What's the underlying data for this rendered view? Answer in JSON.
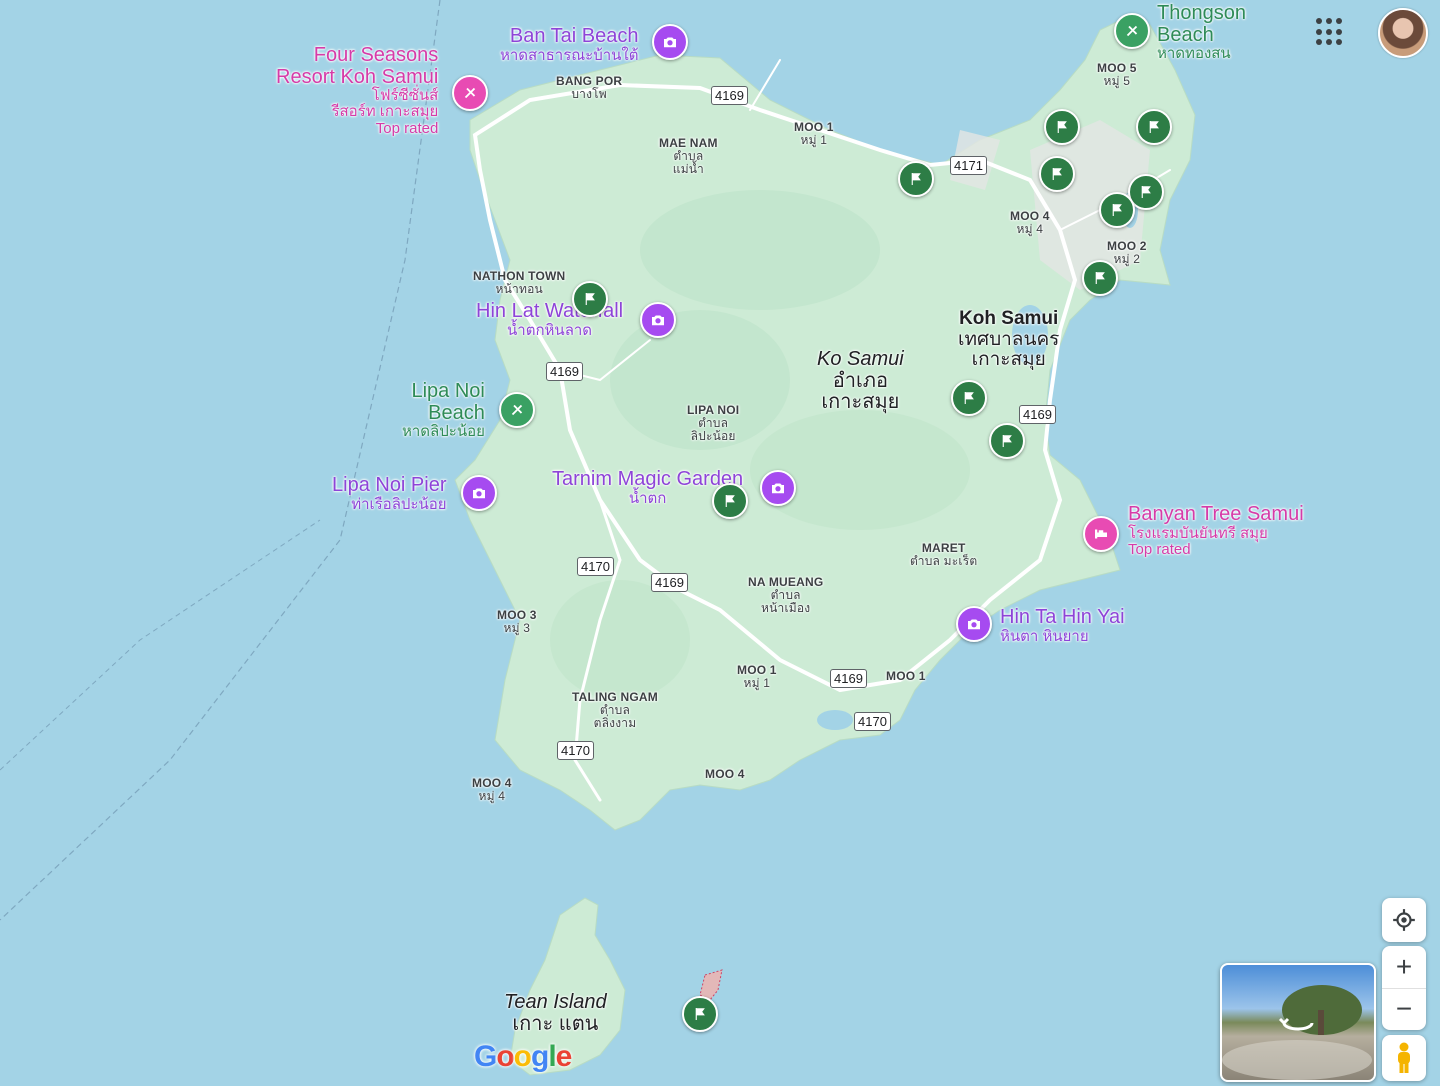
{
  "map": {
    "colors": {
      "water": "#a3d3e6",
      "land": "#cdebd5",
      "land_dark": "#b8e0c2",
      "urban": "#e8eaed",
      "road": "#ffffff"
    },
    "areas": [
      {
        "en": "BANG POR",
        "th": "บางโพ"
      },
      {
        "en": "MAE NAM",
        "th": "ตำบล\nแม่น้ำ"
      },
      {
        "en": "MOO 1",
        "th": "หมู่ 1"
      },
      {
        "en": "MOO 5",
        "th": "หมู่ 5"
      },
      {
        "en": "MOO 4",
        "th": "หมู่ 4"
      },
      {
        "en": "MOO 2",
        "th": "หมู่ 2"
      },
      {
        "en": "NATHON TOWN",
        "th": "หน้าทอน"
      },
      {
        "en": "LIPA NOI",
        "th": "ตำบล\nลิปะน้อย"
      },
      {
        "en": "MARET",
        "th": "ตำบล มะเร็ต"
      },
      {
        "en": "NA MUEANG",
        "th": "ตำบล\nหน้าเมือง"
      },
      {
        "en": "MOO 3",
        "th": "หมู่ 3"
      },
      {
        "en": "MOO 1",
        "th": "หมู่ 1"
      },
      {
        "en": "MOO 1",
        "th": ""
      },
      {
        "en": "TALING NGAM",
        "th": "ตำบล\nตลิ่งงาม"
      },
      {
        "en": "MOO 4",
        "th": "หมู่ 4"
      },
      {
        "en": "MOO 4",
        "th": ""
      }
    ],
    "city": {
      "en": "Koh Samui",
      "th": "เทศบาลนคร\nเกาะสมุย"
    },
    "district": {
      "en": "Ko Samui",
      "th": "อำเภอ\nเกาะสมุย"
    },
    "island": {
      "en": "Tean Island",
      "th": "เกาะ แตน"
    },
    "pois": {
      "ban_tai_beach": {
        "name": "Ban Tai Beach",
        "th": "หาดสาธารณะบ้านใต้",
        "icon": "camera-icon"
      },
      "four_seasons": {
        "name": "Four Seasons\nResort Koh Samui",
        "th": "โฟร์ซีซั่นส์\nรีสอร์ท เกาะสมุย",
        "badge": "Top rated",
        "icon": "resort-icon"
      },
      "thongson_beach": {
        "name": "Thongson\nBeach",
        "th": "หาดทองสน",
        "icon": "beach-icon"
      },
      "hin_lat_waterfall": {
        "name": "Hin Lat Waterfall",
        "th": "น้ำตกหินลาด",
        "icon": "camera-icon"
      },
      "lipa_noi_beach": {
        "name": "Lipa Noi\nBeach",
        "th": "หาดลิปะน้อย",
        "icon": "beach-icon"
      },
      "lipa_noi_pier": {
        "name": "Lipa Noi Pier",
        "th": "ท่าเรือลิปะน้อย",
        "icon": "camera-icon"
      },
      "tarnim_magic_garden": {
        "name": "Tarnim Magic Garden",
        "th": "น้ำตก",
        "icon": "camera-icon"
      },
      "banyan_tree": {
        "name": "Banyan Tree Samui",
        "th": "โรงแรมบันยันทรี สมุย",
        "badge": "Top rated",
        "icon": "hotel-icon"
      },
      "hin_ta_hin_yai": {
        "name": "Hin Ta Hin Yai",
        "th": "หินตา หินยาย",
        "icon": "camera-icon"
      }
    },
    "roads": [
      "4169",
      "4171",
      "4169",
      "4169",
      "4170",
      "4169",
      "4169",
      "4170",
      "4170"
    ]
  },
  "controls": {
    "my_location_icon": "crosshair-icon",
    "zoom_in": "+",
    "zoom_out": "−",
    "pegman_icon": "pegman-icon",
    "apps_icon": "apps-grid-icon",
    "logo": "Google"
  }
}
